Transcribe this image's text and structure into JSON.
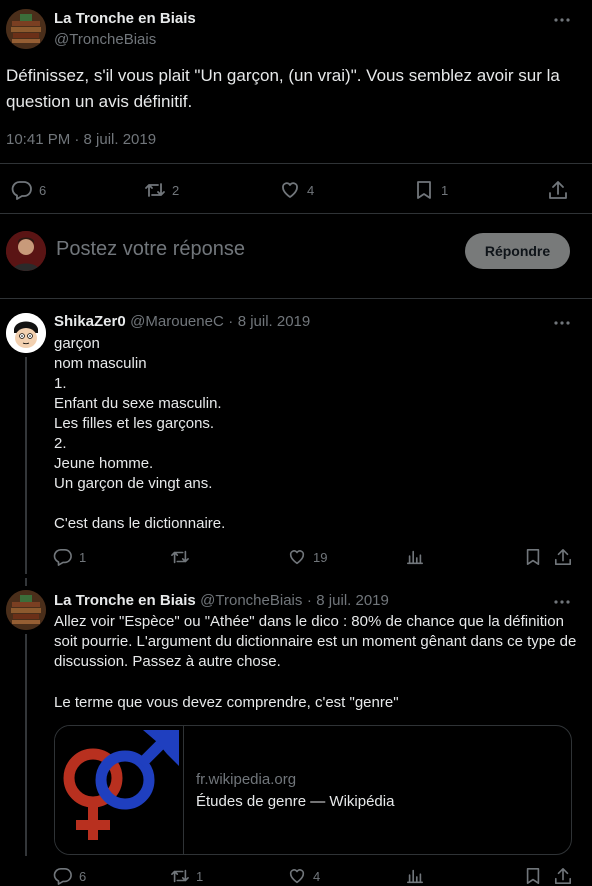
{
  "main_tweet": {
    "author_name": "La Tronche en Biais",
    "author_handle": "@TroncheBiais",
    "text": "Définissez, s'il vous plait \"Un garçon, (un vrai)\". Vous semblez avoir sur la question un avis définitif.",
    "timestamp": "10:41 PM · 8 juil. 2019",
    "replies": "6",
    "retweets": "2",
    "likes": "4",
    "bookmarks": "1"
  },
  "reply_box": {
    "placeholder": "Postez votre réponse",
    "button_label": "Répondre"
  },
  "reply1": {
    "author_name": "ShikaZer0",
    "author_handle": "@MaroueneC",
    "dot": "·",
    "date": "8 juil. 2019",
    "lines": [
      "garçon",
      "nom masculin",
      "1.",
      "Enfant du sexe masculin.",
      "Les filles et les garçons.",
      "2.",
      "Jeune homme.",
      "Un garçon de vingt ans.",
      "",
      "C'est dans le dictionnaire."
    ],
    "replies": "1",
    "likes": "19"
  },
  "reply2": {
    "author_name": "La Tronche en Biais",
    "author_handle": "@TroncheBiais",
    "dot": "·",
    "date": "8 juil. 2019",
    "text1": "Allez voir \"Espèce\" ou \"Athée\" dans le dico : 80% de chance que la définition soit pourrie. L'argument du dictionnaire est un moment gênant dans ce type de discussion. Passez à autre chose.",
    "text2": "Le terme que vous devez comprendre, c'est \"genre\"",
    "card": {
      "domain": "fr.wikipedia.org",
      "title": "Études de genre — Wikipédia"
    },
    "replies": "6",
    "retweets": "1",
    "likes": "4"
  },
  "colors": {
    "background": "#000000",
    "text": "#e7e9ea",
    "muted": "#71767b",
    "divider": "#2f3336",
    "button_bg": "#787a7a",
    "female_symbol": "#b8301f",
    "male_symbol": "#1f3fbf"
  }
}
